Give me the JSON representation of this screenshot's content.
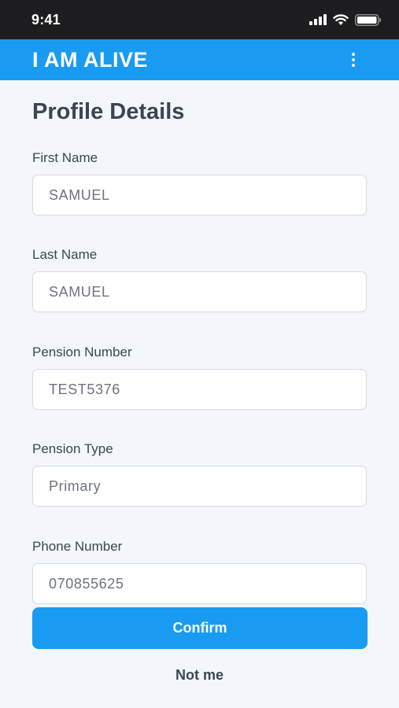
{
  "status_bar": {
    "time": "9:41",
    "icons": [
      "signal-icon",
      "wifi-icon",
      "battery-icon"
    ]
  },
  "app_bar": {
    "title": "I AM ALIVE",
    "menu_icon": "more-vert-icon",
    "color": "#1a9bf2"
  },
  "page": {
    "title": "Profile Details"
  },
  "fields": [
    {
      "label": "First Name",
      "value": "SAMUEL"
    },
    {
      "label": "Last Name",
      "value": "SAMUEL"
    },
    {
      "label": "Pension Number",
      "value": "TEST5376"
    },
    {
      "label": "Pension Type",
      "value": "Primary"
    },
    {
      "label": "Phone Number",
      "value": "070855625"
    }
  ],
  "actions": {
    "confirm_label": "Confirm",
    "not_me_label": "Not me"
  }
}
